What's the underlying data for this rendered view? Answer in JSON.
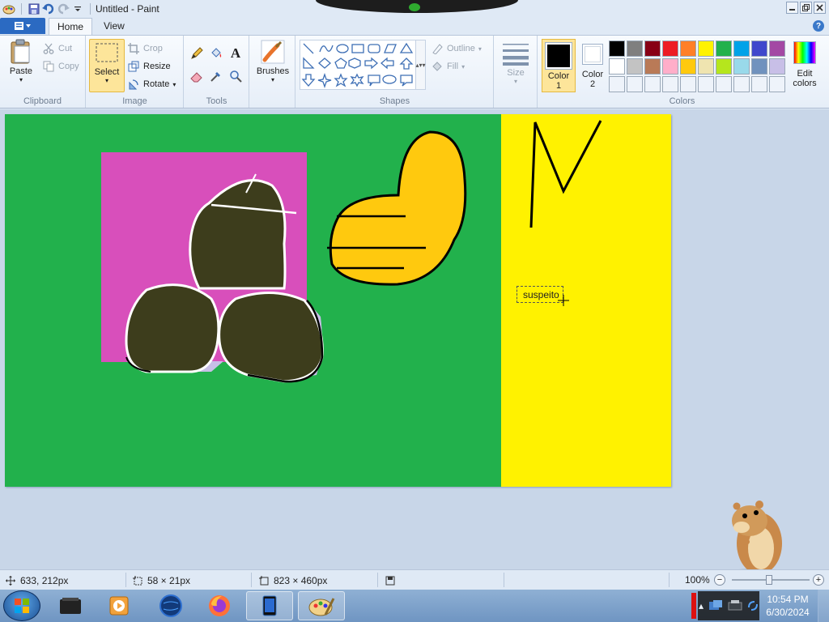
{
  "window": {
    "title": "Untitled - Paint",
    "icons": {
      "app": "paint-app-icon",
      "save": "save-icon",
      "undo": "undo-icon",
      "redo": "redo-icon"
    }
  },
  "ribbon": {
    "tabs": [
      {
        "label": "Home",
        "active": true
      },
      {
        "label": "View",
        "active": false
      }
    ],
    "clipboard": {
      "label": "Clipboard",
      "paste": "Paste",
      "cut": "Cut",
      "copy": "Copy"
    },
    "image": {
      "label": "Image",
      "select": "Select",
      "crop": "Crop",
      "resize": "Resize",
      "rotate": "Rotate"
    },
    "tools": {
      "label": "Tools"
    },
    "brushes": {
      "label": "Brushes"
    },
    "shapes": {
      "label": "Shapes",
      "outline": "Outline",
      "fill": "Fill"
    },
    "size": {
      "label": "Size"
    },
    "colors": {
      "label": "Colors",
      "color1": "Color",
      "color1_num": "1",
      "color2": "Color",
      "color2_num": "2",
      "edit": "Edit",
      "edit2": "colors",
      "color1_value": "#000000",
      "color2_value": "#ffffff",
      "palette": [
        "#000000",
        "#7f7f7f",
        "#880015",
        "#ed1c24",
        "#ff7f27",
        "#fff200",
        "#22b14c",
        "#00a2e8",
        "#3f48cc",
        "#a349a4",
        "#ffffff",
        "#c3c3c3",
        "#b97a57",
        "#ffaec9",
        "#ffc90e",
        "#efe4b0",
        "#b5e61d",
        "#99d9ea",
        "#7092be",
        "#c8bfe7",
        "#eef3fa",
        "#eef3fa",
        "#eef3fa",
        "#eef3fa",
        "#eef3fa",
        "#eef3fa",
        "#eef3fa",
        "#eef3fa",
        "#eef3fa",
        "#eef3fa"
      ]
    }
  },
  "canvas": {
    "background": "#22b14c",
    "text_box_content": "suspeito",
    "colors": {
      "pink": "#d84fbb",
      "yellow": "#fff200",
      "dark_olive": "#3d3d1c",
      "orange": "#ffc90e",
      "lavender": "#c8bfe7"
    }
  },
  "status": {
    "cursor_pos": "633, 212px",
    "selection_size": "58 × 21px",
    "canvas_size": "823 × 460px",
    "zoom": "100%"
  },
  "taskbar": {
    "time": "10:54 PM",
    "date": "6/30/2024",
    "items": [
      "media-player-icon",
      "media-center-icon",
      "globe-app-icon",
      "firefox-icon",
      "tablet-app-icon",
      "paint-taskbar-icon"
    ]
  }
}
